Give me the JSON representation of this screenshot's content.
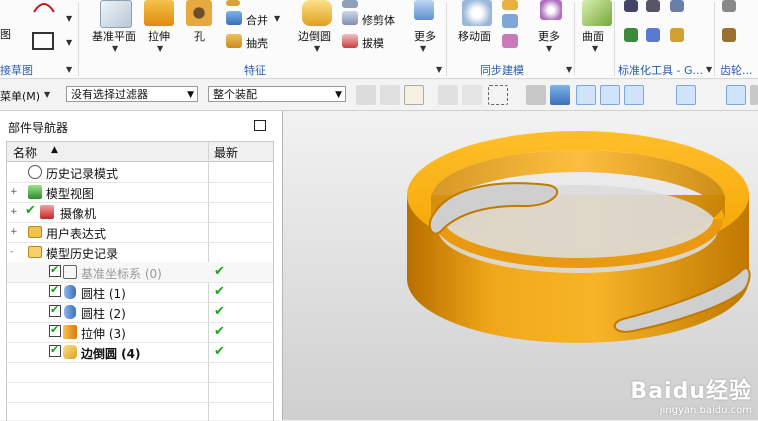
{
  "ribbon": {
    "left_cut_label": "图",
    "bottom_left_label": "接草图",
    "buttons": {
      "datum_plane": "基准平面",
      "extrude": "拉伸",
      "hole": "孔",
      "unite": "合并",
      "shell": "抽壳",
      "edge_blend": "边倒圆",
      "trim_body": "修剪体",
      "draft": "拔模",
      "more_feature": "更多",
      "move_face": "移动面",
      "more_sync": "更多",
      "surface": "曲面"
    },
    "groups": {
      "feature": "特征",
      "sync": "同步建模",
      "standard_tools": "标准化工具 - G...",
      "gear": "齿轮..."
    },
    "hidden_top_label": "修剪体"
  },
  "toolbar": {
    "menu_label": "菜单(M)",
    "filter_select": "没有选择过滤器",
    "assembly_select": "整个装配"
  },
  "navigator": {
    "title": "部件导航器",
    "columns": {
      "name": "名称",
      "latest": "最新"
    },
    "rows": [
      {
        "label": "历史记录模式",
        "icon": "clock-icon",
        "level": 0,
        "expander": ""
      },
      {
        "label": "模型视图",
        "icon": "model-view-icon",
        "level": 0,
        "expander": "+"
      },
      {
        "label": "摄像机",
        "icon": "camera-icon",
        "level": 0,
        "expander": "+"
      },
      {
        "label": "用户表达式",
        "icon": "folder-icon",
        "level": 0,
        "expander": "+"
      },
      {
        "label": "模型历史记录",
        "icon": "folder-open-icon",
        "level": 0,
        "expander": "-"
      },
      {
        "label": "基准坐标系 (0)",
        "icon": "datum-csys-icon",
        "level": 1,
        "latest": "✔"
      },
      {
        "label": "圆柱 (1)",
        "icon": "cylinder-icon",
        "level": 1,
        "latest": "✔"
      },
      {
        "label": "圆柱 (2)",
        "icon": "cylinder-icon",
        "level": 1,
        "latest": "✔"
      },
      {
        "label": "拉伸 (3)",
        "icon": "extrude-icon",
        "level": 1,
        "latest": "✔"
      },
      {
        "label": "边倒圆 (4)",
        "icon": "edge-blend-icon",
        "level": 1,
        "latest": "✔"
      }
    ]
  },
  "watermark": {
    "logo": "Baidu经验",
    "url": "jingyan.baidu.com"
  },
  "colors": {
    "part": "#f2a000",
    "group_label": "#2a5da8",
    "check": "#1ca51c"
  }
}
